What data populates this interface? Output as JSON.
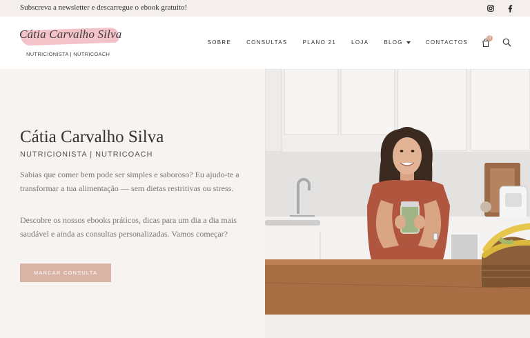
{
  "topbar": {
    "promo": "Subscreva a newsletter e descarregue o ebook gratuito!",
    "social": [
      {
        "icon": "instagram-icon"
      },
      {
        "icon": "facebook-icon"
      }
    ]
  },
  "header": {
    "logo": {
      "script": "Cátia Carvalho Silva",
      "subtitle": "NUTRICIONISTA | NUTRICOACH",
      "accent": "#f2bcc3"
    },
    "nav": [
      {
        "label": "SOBRE"
      },
      {
        "label": "CONSULTAS"
      },
      {
        "label": "PLANO 21"
      },
      {
        "label": "LOJA"
      },
      {
        "label": "BLOG",
        "dropdown": true
      },
      {
        "label": "CONTACTOS"
      }
    ],
    "cart_count": "0",
    "icons": [
      "cart-icon",
      "search-icon"
    ]
  },
  "hero": {
    "title": "Cátia Carvalho Silva",
    "subtitle": "NUTRICIONISTA | NUTRICOACH",
    "paragraph1": "Sabias que comer bem pode ser simples e saboroso? Eu ajudo-te a transformar a tua alimentação — sem dietas restritivas ou stress.",
    "paragraph2": "Descobre os nossos ebooks práticos, dicas para um dia a dia mais saudável e ainda as consultas personalizadas. Vamos começar?",
    "cta_label": "MARCAR CONSULTA",
    "cta_color": "#d8b3a6",
    "background": "#f6f3f1"
  }
}
